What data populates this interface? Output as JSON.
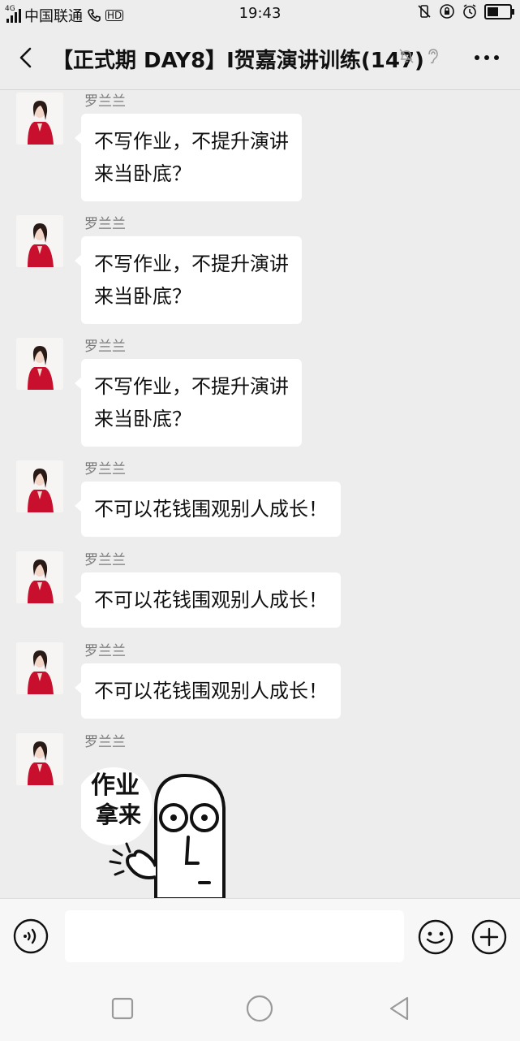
{
  "status": {
    "network_type": "4G",
    "carrier": "中国联通",
    "hd_badge": "HD",
    "time": "19:43",
    "battery_level": 0.55
  },
  "chat": {
    "title": "【正式期 DAY8】I贺嘉演讲训练(147)",
    "muted_icon": "bell-off-icon",
    "earpiece_icon": "ear-icon"
  },
  "messages": [
    {
      "sender": "罗兰兰",
      "text_lines": [
        "不写作业，不提升演讲",
        "来当卧底？"
      ]
    },
    {
      "sender": "罗兰兰",
      "text_lines": [
        "不写作业，不提升演讲",
        "来当卧底？"
      ]
    },
    {
      "sender": "罗兰兰",
      "text_lines": [
        "不写作业，不提升演讲",
        "来当卧底？"
      ]
    },
    {
      "sender": "罗兰兰",
      "text_lines": [
        "不可以花钱围观别人成长！"
      ]
    },
    {
      "sender": "罗兰兰",
      "text_lines": [
        "不可以花钱围观别人成长！"
      ]
    },
    {
      "sender": "罗兰兰",
      "text_lines": [
        "不可以花钱围观别人成长！"
      ]
    },
    {
      "sender": "罗兰兰",
      "sticker": true
    }
  ],
  "sticker": {
    "line1": "作业",
    "line2": "拿来"
  },
  "input": {
    "placeholder": ""
  },
  "colors": {
    "background": "#ededed",
    "bubble": "#ffffff",
    "avatar_red": "#c8102e"
  }
}
